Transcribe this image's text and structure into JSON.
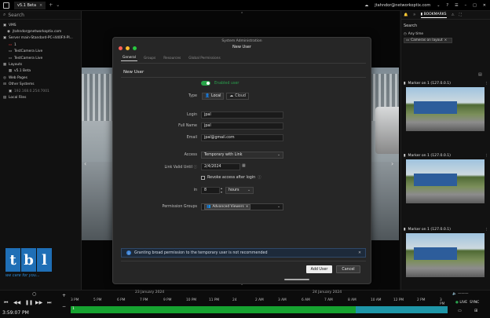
{
  "topbar": {
    "tab_label": "v5.1 Beta",
    "user_email": "jtahndor@networkoptix.com",
    "icons": [
      "cloud-icon",
      "help-icon",
      "settings-icon",
      "minimize-icon",
      "maximize-icon",
      "close-icon"
    ]
  },
  "left_panel": {
    "search_placeholder": "Search",
    "tree": [
      {
        "label": "VMS",
        "icon": "server-icon",
        "red": false,
        "dim": false
      },
      {
        "label": "jtahndor@networkoptix.com",
        "icon": "user-icon",
        "red": false,
        "dim": false
      },
      {
        "label": "Server main-Standard-PC-i440FX-PI...",
        "icon": "server-icon",
        "red": false,
        "dim": false
      },
      {
        "label": "1",
        "icon": "camera-icon",
        "red": true,
        "dim": false
      },
      {
        "label": "TestCamera Live",
        "icon": "camera-icon",
        "red": false,
        "dim": false
      },
      {
        "label": "TestCamera Live",
        "icon": "camera-icon",
        "red": false,
        "dim": false
      },
      {
        "label": "Layouts",
        "icon": "layout-icon",
        "red": false,
        "dim": false
      },
      {
        "label": "v5.1 Beta",
        "icon": "layout-icon",
        "red": false,
        "dim": false
      },
      {
        "label": "Web Pages",
        "icon": "web-icon",
        "red": false,
        "dim": false
      },
      {
        "label": "Other Systems",
        "icon": "system-icon",
        "red": false,
        "dim": false
      },
      {
        "label": "192.168.0.254:7001",
        "icon": "server-icon",
        "red": false,
        "dim": true
      },
      {
        "label": "Local Files",
        "icon": "folder-icon",
        "red": false,
        "dim": false
      }
    ],
    "logo_letters": [
      "t",
      "b",
      "l"
    ],
    "logo_tagline": "we care for you..."
  },
  "dialog": {
    "system_title": "System Administration",
    "title": "New User",
    "tabs": [
      "General",
      "Groups",
      "Resources",
      "Global Permissions"
    ],
    "heading": "New User",
    "enabled_label": "Enabled user",
    "type_label": "Type",
    "type_local": "Local",
    "type_cloud": "Cloud",
    "login_label": "Login",
    "login_value": "jpal",
    "fullname_label": "Full Name",
    "fullname_value": "jpal",
    "email_label": "Email",
    "email_value": "jpal@gmail.com",
    "access_label": "Access",
    "access_value": "Temporary with Link",
    "linkvalid_label": "Link Valid Until",
    "linkvalid_value": "2/4/2024",
    "revoke_label": "Revoke access after login",
    "in_label": "in",
    "in_value": "8",
    "in_unit": "hours",
    "perm_label": "Permission Groups",
    "perm_chip": "Advanced Viewers",
    "warning": "Granting broad permission to the temporary user is not recommended",
    "add_button": "Add User",
    "cancel_button": "Cancel"
  },
  "right_panel": {
    "tab_bookmarks": "BOOKMARKS",
    "search_label": "Search",
    "filter_any_time": "Any time",
    "filter_cameras": "Cameras on layout",
    "bookmarks": [
      {
        "title": "Marker on 1 (127.0.0.1)"
      },
      {
        "title": "Marker on 1 (127.0.0.1)"
      },
      {
        "title": "Marker on 1 (127.0.0.1)"
      }
    ]
  },
  "timeline": {
    "clock": "3:59:07 PM",
    "date_left": "23 January 2024",
    "date_right": "24 January 2024",
    "ticks": [
      "3 PM",
      "5 PM",
      "6 PM",
      "7 PM",
      "9 PM",
      "10 PM",
      "11 PM",
      "24",
      "2 AM",
      "3 AM",
      "6 AM",
      "7 AM",
      "8 AM",
      "10 AM",
      "12 PM",
      "2 PM",
      "3 PM"
    ],
    "live_label": "LIVE",
    "sync_label": "SYNC",
    "marker_label": "1"
  }
}
